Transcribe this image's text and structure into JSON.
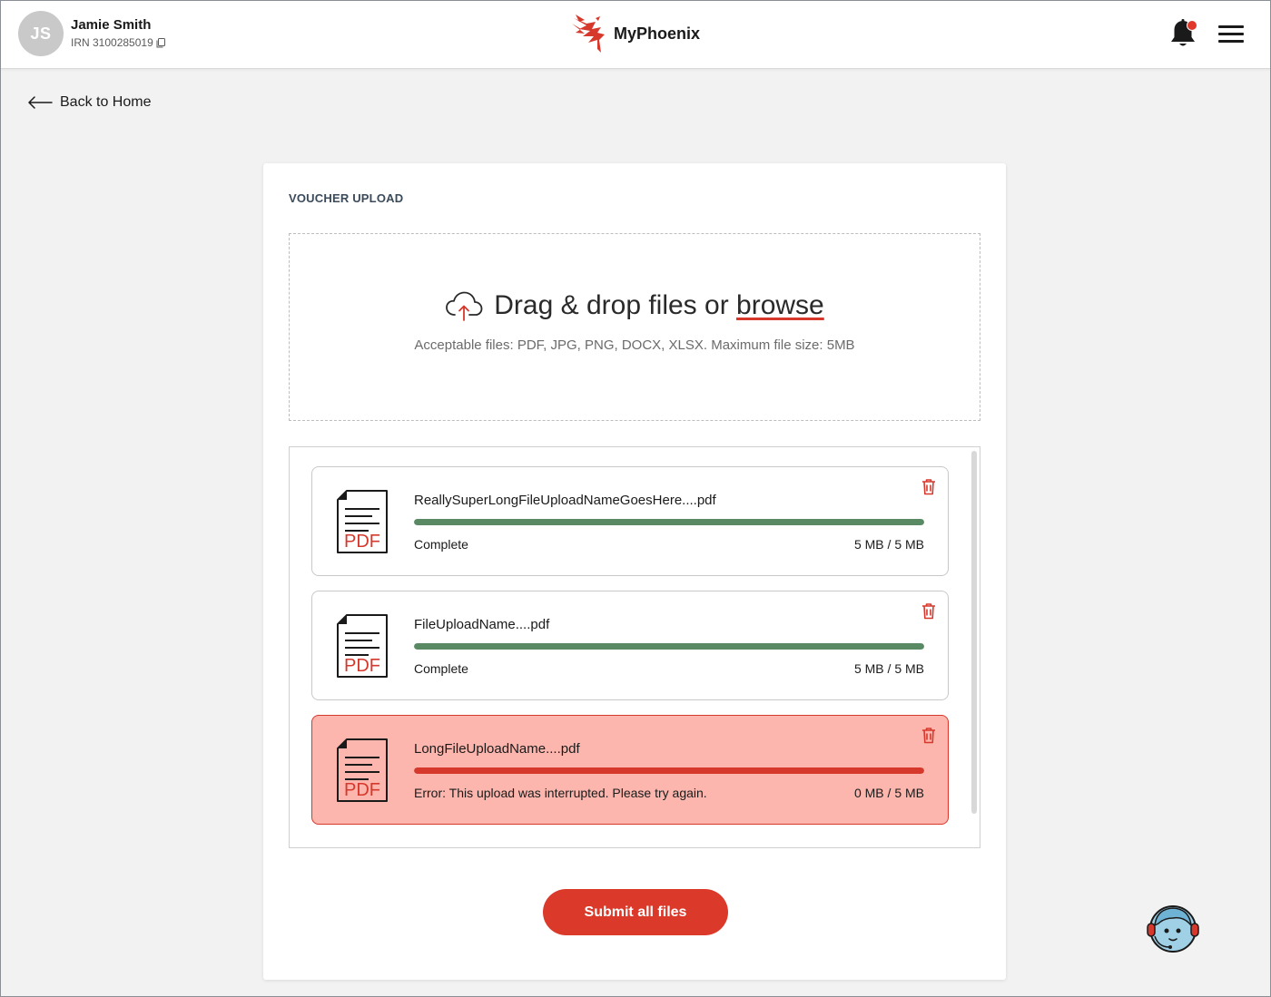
{
  "header": {
    "avatar_initials": "JS",
    "user_name": "Jamie Smith",
    "irn": "IRN 3100285019",
    "brand_name": "MyPhoenix",
    "notification_dot_color": "#e0382a"
  },
  "nav": {
    "back_label": "Back to Home"
  },
  "card": {
    "title": "VOUCHER UPLOAD",
    "dropzone": {
      "text_prefix": "Drag & drop files or ",
      "browse_label": "browse",
      "subtext": "Acceptable files: PDF, JPG, PNG, DOCX, XLSX. Maximum file size: 5MB"
    },
    "files": [
      {
        "name": "ReallySuperLongFileUploadNameGoesHere....pdf",
        "status": "Complete",
        "size": "5 MB / 5 MB",
        "progress": 1.0,
        "state": "complete",
        "icon_label": "PDF"
      },
      {
        "name": "FileUploadName....pdf",
        "status": "Complete",
        "size": "5 MB / 5 MB",
        "progress": 1.0,
        "state": "complete",
        "icon_label": "PDF"
      },
      {
        "name": "LongFileUploadName....pdf",
        "status": "Error: This upload was interrupted. Please try again.",
        "size": "0 MB / 5 MB",
        "progress": 1.0,
        "state": "error",
        "icon_label": "PDF"
      }
    ],
    "submit_label": "Submit all files"
  },
  "colors": {
    "accent": "#db3a2b",
    "progress_complete": "#5a8a63",
    "progress_error": "#d6382c",
    "error_background": "#fcb6ad"
  }
}
